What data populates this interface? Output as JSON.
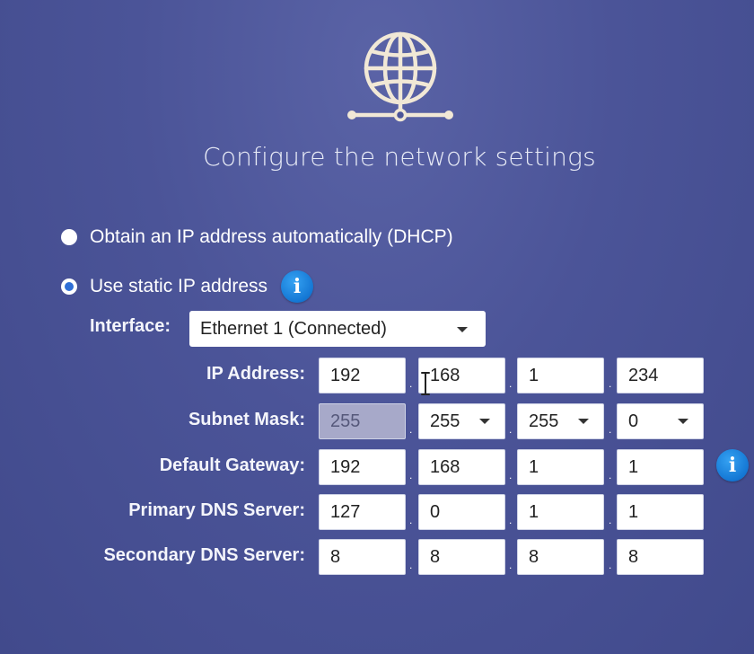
{
  "title": "Configure the network settings",
  "icons": {
    "globe": "globe-network-icon",
    "info": "info-icon"
  },
  "options": {
    "dhcp_label": "Obtain an IP address automatically (DHCP)",
    "static_label": "Use static IP address",
    "selected": "static"
  },
  "interface": {
    "label": "Interface:",
    "value": "Ethernet 1 (Connected)"
  },
  "fields": {
    "ip": {
      "label": "IP Address:",
      "o1": "192",
      "o2": "168",
      "o3": "1",
      "o4": "234"
    },
    "subnet": {
      "label": "Subnet Mask:",
      "o1": "255",
      "o2": "255",
      "o3": "255",
      "o4": "0"
    },
    "gateway": {
      "label": "Default Gateway:",
      "o1": "192",
      "o2": "168",
      "o3": "1",
      "o4": "1"
    },
    "dns1": {
      "label": "Primary DNS Server:",
      "o1": "127",
      "o2": "0",
      "o3": "1",
      "o4": "1"
    },
    "dns2": {
      "label": "Secondary DNS Server:",
      "o1": "8",
      "o2": "8",
      "o3": "8",
      "o4": "8"
    }
  },
  "separator": ".",
  "info_glyph": "i",
  "colors": {
    "background": "#4b5498",
    "info_blue": "#1477d4",
    "radio_selected": "#2f6fd6"
  }
}
